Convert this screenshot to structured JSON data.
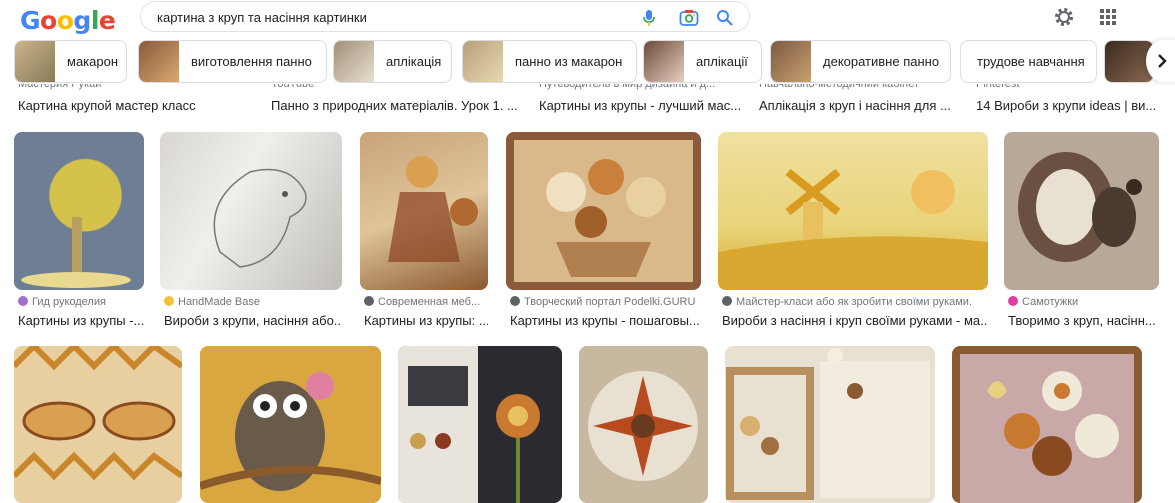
{
  "search": {
    "query": "картина з круп та насіння картинки"
  },
  "logo": {
    "letters": [
      "G",
      "o",
      "o",
      "g",
      "l",
      "e"
    ],
    "colors": [
      "#4285F4",
      "#EA4335",
      "#FBBC05",
      "#4285F4",
      "#34A853",
      "#EA4335"
    ]
  },
  "chips": [
    {
      "label": "макарон",
      "swatch": "#c9b58a"
    },
    {
      "label": "виготовлення панно",
      "swatch": "#8a5a3a"
    },
    {
      "label": "аплікація",
      "swatch": "#a08f78"
    },
    {
      "label": "панно из макарон",
      "swatch": "#b8a07a"
    },
    {
      "label": "аплікації",
      "swatch": "#6b4a3a"
    },
    {
      "label": "декоративне панно",
      "swatch": "#7a5a40"
    },
    {
      "label": "трудове навчання",
      "swatch": null
    },
    {
      "label": "",
      "swatch": "#3a2a20"
    }
  ],
  "top_row": [
    {
      "source": "Мастерия Рукай",
      "title": "Картина крупой мастер класс"
    },
    {
      "source": "YouTube",
      "title": "Панно з природних матеріалів. Урок 1. ..."
    },
    {
      "source": "Путеводитель в мир дизайна и д...",
      "title": "Картины из крупы - лучший мас..."
    },
    {
      "source": "Навчально-методичний кабінет",
      "title": "Аплікація з круп і насіння для ..."
    },
    {
      "source": "Pinterest",
      "title": "14 Вироби з крупи ideas | ви..."
    }
  ],
  "middle_row": [
    {
      "source": "Гид рукоделия",
      "title": "Картины из крупы -...",
      "img": [
        "#7f8fa8",
        "#c9b54a"
      ]
    },
    {
      "source": "HandMade Base",
      "title": "Вироби з крупи, насіння або...",
      "img": [
        "#e8e6e2",
        "#b5b2ad"
      ]
    },
    {
      "source": "Современная меб...",
      "title": "Картины из крупы: ...",
      "img": [
        "#c9a37a",
        "#7a4a2a"
      ]
    },
    {
      "source": "Творческий портал Podelki.GURU",
      "title": "Картины из крупы - пошаговы...",
      "img": [
        "#8a5a3a",
        "#e8c890"
      ]
    },
    {
      "source": "Майстер-класи або як зробити своїми руками.",
      "title": "Вироби з насіння і круп своїми руками - ма...",
      "img": [
        "#e8d47a",
        "#d9a830"
      ]
    },
    {
      "source": "Самоτужки",
      "title": "Творимо з круп, насінн...",
      "img": [
        "#a89a8a",
        "#4a3a30"
      ]
    }
  ],
  "bottom_row": [
    {
      "img": [
        "#e8cfa0",
        "#c9862a"
      ]
    },
    {
      "img": [
        "#d9a640",
        "#6a5a4a"
      ]
    },
    {
      "img": [
        "#2a2a30",
        "#c99a50"
      ]
    },
    {
      "img": [
        "#c9b8a0",
        "#8a3a20"
      ]
    },
    {
      "img": [
        "#e8e0d0",
        "#b89060"
      ]
    },
    {
      "img": [
        "#c9a8a8",
        "#8a5a30"
      ]
    }
  ]
}
